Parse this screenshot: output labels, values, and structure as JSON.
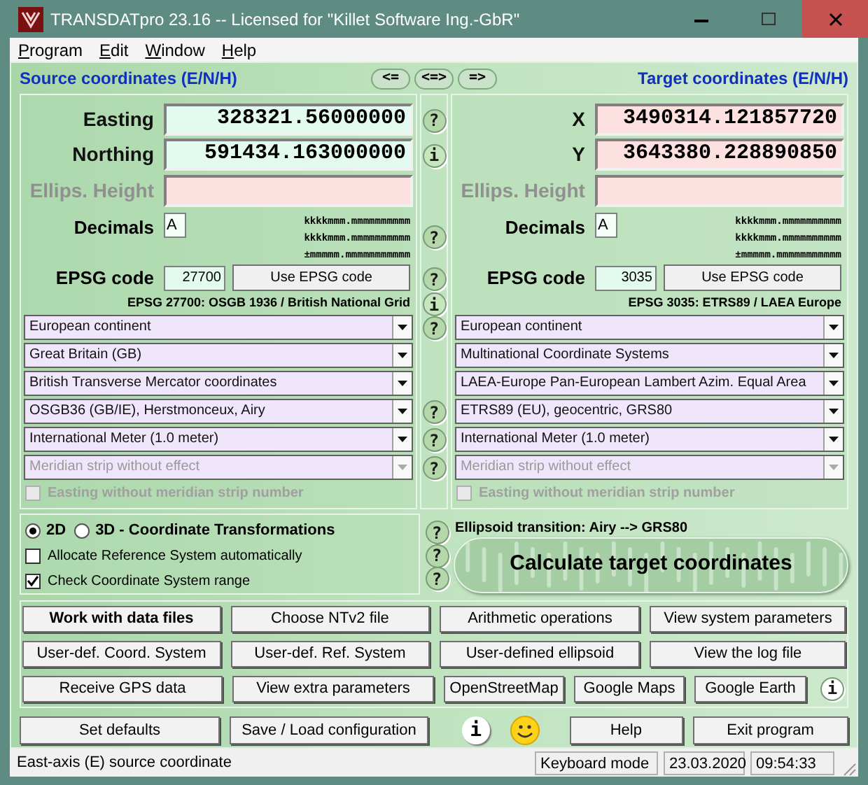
{
  "window": {
    "title": "TRANSDATpro 23.16 -- Licensed for \"Killet Software Ing.-GbR\""
  },
  "menu": [
    "Program",
    "Edit",
    "Window",
    "Help"
  ],
  "swap_buttons": [
    "<=",
    "<=>",
    "=>"
  ],
  "source": {
    "title": "Source coordinates (E/N/H)",
    "fields": [
      {
        "label": "Easting",
        "value": "328321.56000000",
        "kind": "input",
        "disabled": false
      },
      {
        "label": "Northing",
        "value": "591434.163000000",
        "kind": "input",
        "disabled": false
      },
      {
        "label": "Ellips. Height",
        "kind": "output",
        "disabled": true
      }
    ],
    "decimals": {
      "label": "Decimals",
      "value": "A",
      "formats": [
        "kkkkmmm.mmmmmmmmmm",
        "kkkkmmm.mmmmmmmmmm",
        "±mmmmm.mmmmmmmmmmm"
      ]
    },
    "epsg": {
      "label": "EPSG code",
      "value": "27700",
      "button": "Use EPSG code",
      "description": "EPSG 27700: OSGB 1936 / British National Grid"
    },
    "dropdowns": [
      {
        "value": "European continent",
        "disabled": false
      },
      {
        "value": "Great Britain (GB)",
        "disabled": false
      },
      {
        "value": "British Transverse Mercator coordinates",
        "disabled": false
      },
      {
        "value": "OSGB36 (GB/IE), Herstmonceux, Airy",
        "disabled": false
      },
      {
        "value": "International Meter (1.0 meter)",
        "disabled": false
      },
      {
        "value": "Meridian strip without effect",
        "disabled": true
      }
    ],
    "checkbox": {
      "label": "Easting without meridian strip number",
      "checked": false,
      "disabled": true
    }
  },
  "target": {
    "title": "Target coordinates (E/N/H)",
    "fields": [
      {
        "label": "X",
        "value": "3490314.121857720",
        "kind": "output",
        "disabled": false
      },
      {
        "label": "Y",
        "value": "3643380.228890850",
        "kind": "output",
        "disabled": false
      },
      {
        "label": "Ellips. Height",
        "kind": "output",
        "disabled": true
      }
    ],
    "decimals": {
      "label": "Decimals",
      "value": "A",
      "formats": [
        "kkkkmmm.mmmmmmmmmm",
        "kkkkmmm.mmmmmmmmmm",
        "±mmmmm.mmmmmmmmmmm"
      ]
    },
    "epsg": {
      "label": "EPSG code",
      "value": "3035",
      "button": "Use EPSG code",
      "description": "EPSG 3035: ETRS89 / LAEA Europe"
    },
    "dropdowns": [
      {
        "value": "European continent",
        "disabled": false
      },
      {
        "value": "Multinational Coordinate Systems",
        "disabled": false
      },
      {
        "value": "LAEA-Europe Pan-European Lambert Azim. Equal Area",
        "disabled": false
      },
      {
        "value": "ETRS89 (EU), geocentric, GRS80",
        "disabled": false
      },
      {
        "value": "International Meter (1.0 meter)",
        "disabled": false
      },
      {
        "value": "Meridian strip without effect",
        "disabled": true
      }
    ],
    "checkbox": {
      "label": "Easting without meridian strip number",
      "checked": false,
      "disabled": true
    }
  },
  "help_icons": [
    {
      "kind": "help",
      "symbol": "?"
    },
    {
      "kind": "info",
      "symbol": "i"
    },
    {
      "kind": "help",
      "symbol": "?"
    },
    {
      "kind": "help",
      "symbol": "?"
    },
    {
      "kind": "info",
      "symbol": "i"
    },
    {
      "kind": "help",
      "symbol": "?"
    },
    {
      "kind": "help",
      "symbol": "?"
    },
    {
      "kind": "help",
      "symbol": "?"
    },
    {
      "kind": "help",
      "symbol": "?"
    }
  ],
  "options": {
    "radios": [
      {
        "label": "2D",
        "selected": true
      },
      {
        "label": "3D - Coordinate Transformations",
        "selected": false
      }
    ],
    "checkboxes": [
      {
        "label": "Allocate Reference System automatically",
        "checked": false
      },
      {
        "label": "Check Coordinate System range",
        "checked": true
      }
    ]
  },
  "option_help_icons": [
    {
      "kind": "help",
      "symbol": "?"
    },
    {
      "kind": "help",
      "symbol": "?"
    },
    {
      "kind": "help",
      "symbol": "?"
    }
  ],
  "ellipsoid_transition": "Ellipsoid transition: Airy --> GRS80",
  "calculate_button": "Calculate target coordinates",
  "button_rows": [
    [
      {
        "kind": "button",
        "label": "Work with data files",
        "bold": true
      },
      {
        "kind": "button",
        "label": "Choose NTv2 file",
        "bold": false
      },
      {
        "kind": "button",
        "label": "Arithmetic operations",
        "bold": false
      },
      {
        "kind": "button",
        "label": "View system parameters",
        "bold": false
      }
    ],
    [
      {
        "kind": "button",
        "label": "User-def. Coord. System",
        "bold": false
      },
      {
        "kind": "button",
        "label": "User-def. Ref. System",
        "bold": false
      },
      {
        "kind": "button",
        "label": "User-defined ellipsoid",
        "bold": false
      },
      {
        "kind": "button",
        "label": "View the log file",
        "bold": false
      }
    ],
    [
      {
        "kind": "button",
        "label": "Receive GPS data",
        "bold": false
      },
      {
        "kind": "button",
        "label": "View extra parameters",
        "bold": false
      },
      {
        "kind": "button",
        "label": "OpenStreetMap",
        "bold": false
      },
      {
        "kind": "button",
        "label": "Google Maps",
        "bold": false
      },
      {
        "kind": "button",
        "label": "Google Earth",
        "bold": false
      },
      {
        "kind": "info",
        "symbol": "i"
      }
    ]
  ],
  "bottom_bar": [
    {
      "kind": "button",
      "label": "Set defaults"
    },
    {
      "kind": "button",
      "label": "Save / Load configuration"
    },
    {
      "kind": "info",
      "symbol": "i"
    },
    {
      "kind": "smiley"
    },
    {
      "kind": "button",
      "label": "Help"
    },
    {
      "kind": "button",
      "label": "Exit program"
    }
  ],
  "status_bar": [
    "East-axis (E) source coordinate",
    "Keyboard mode",
    "23.03.2020",
    "09:54:33"
  ]
}
